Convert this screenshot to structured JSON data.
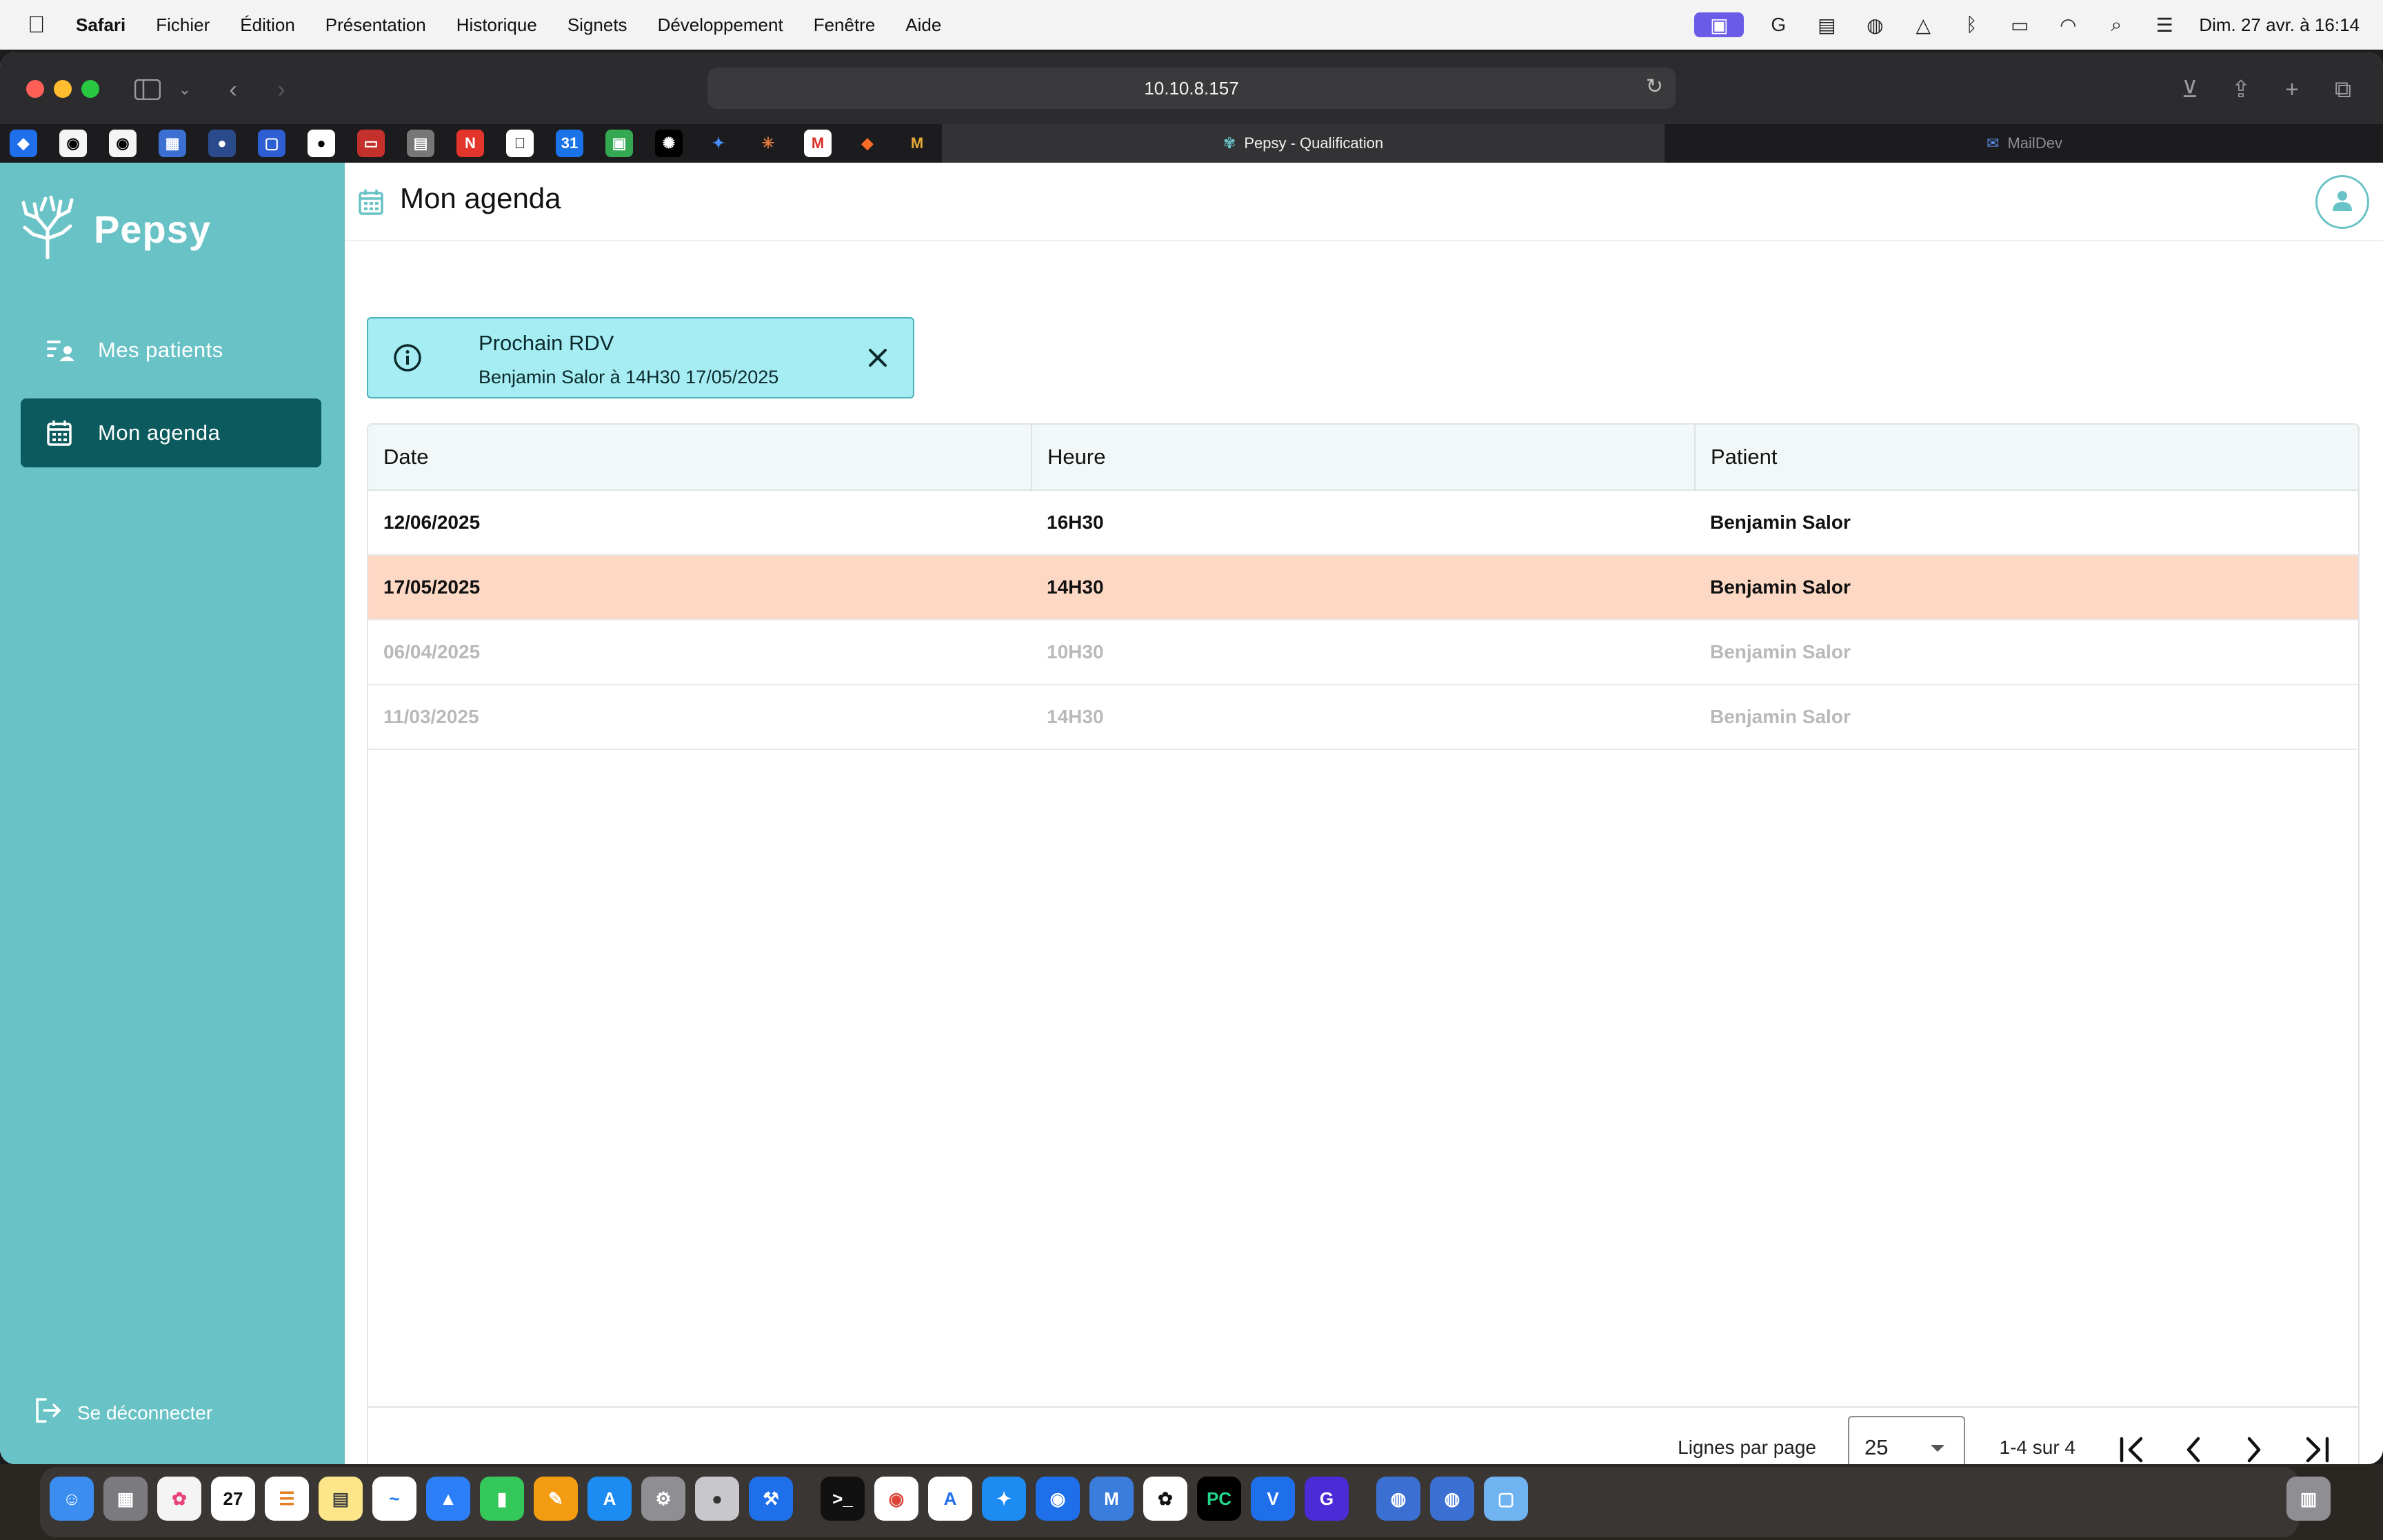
{
  "menubar": {
    "app": "Safari",
    "items": [
      "Fichier",
      "Édition",
      "Présentation",
      "Historique",
      "Signets",
      "Développement",
      "Fenêtre",
      "Aide"
    ],
    "clock": "Dim. 27 avr. à 16:14"
  },
  "browser": {
    "url": "10.10.8.157",
    "tabs": [
      {
        "label": "Pepsy - Qualification"
      },
      {
        "label": "MailDev"
      }
    ]
  },
  "sidebar": {
    "brand": "Pepsy",
    "items": [
      {
        "label": "Mes patients",
        "icon": "patients-list-icon"
      },
      {
        "label": "Mon agenda",
        "icon": "calendar-icon"
      }
    ],
    "logout": "Se déconnecter"
  },
  "header": {
    "title": "Mon agenda"
  },
  "alert": {
    "title": "Prochain RDV",
    "text": "Benjamin Salor à 14H30 17/05/2025"
  },
  "table": {
    "columns": [
      "Date",
      "Heure",
      "Patient"
    ],
    "rows": [
      {
        "date": "12/06/2025",
        "time": "16H30",
        "patient": "Benjamin Salor"
      },
      {
        "date": "17/05/2025",
        "time": "14H30",
        "patient": "Benjamin Salor"
      },
      {
        "date": "06/04/2025",
        "time": "10H30",
        "patient": "Benjamin Salor"
      },
      {
        "date": "11/03/2025",
        "time": "14H30",
        "patient": "Benjamin Salor"
      }
    ]
  },
  "pagination": {
    "rows_per_page_label": "Lignes par page",
    "rows_per_page": "25",
    "range": "1-4 sur 4"
  },
  "colors": {
    "sidebar": "#68c2c6",
    "sidebar_active": "#0b5a5d",
    "alert_bg": "#a5edf3",
    "row_highlight": "#fdd9c5"
  }
}
